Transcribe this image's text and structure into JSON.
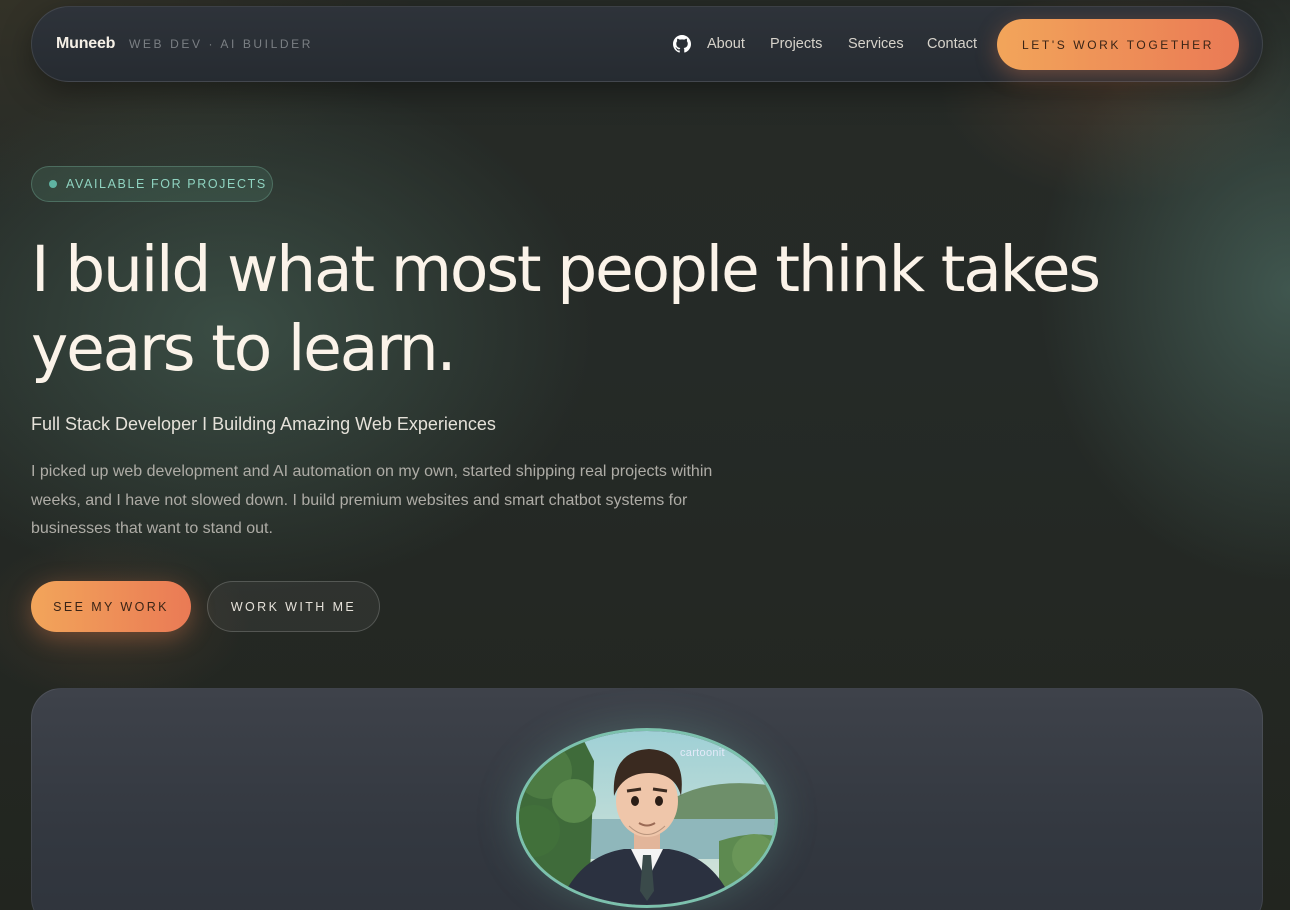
{
  "nav": {
    "brand": "Muneeb",
    "tagline": "WEB DEV · AI BUILDER",
    "links": [
      {
        "label": "About"
      },
      {
        "label": "Projects"
      },
      {
        "label": "Services"
      },
      {
        "label": "Contact"
      }
    ],
    "cta": "LET'S WORK TOGETHER",
    "icon": "github-icon"
  },
  "hero": {
    "badge": "AVAILABLE FOR PROJECTS",
    "headline": "I build what most people think takes years to learn.",
    "subtitle": "Full Stack Developer I Building Amazing Web Experiences",
    "description": "I picked up web development and AI automation on my own, started shipping real projects within weeks, and I have not slowed down. I build premium websites and smart chatbot systems for businesses that want to stand out.",
    "primary_button": "SEE MY WORK",
    "secondary_button": "WORK WITH ME"
  },
  "profile": {
    "avatar_watermark": "cartoonit"
  },
  "colors": {
    "accent_start": "#f2a55a",
    "accent_end": "#ea7a55",
    "badge_text": "#8fd3c0",
    "background": "#22251f"
  }
}
